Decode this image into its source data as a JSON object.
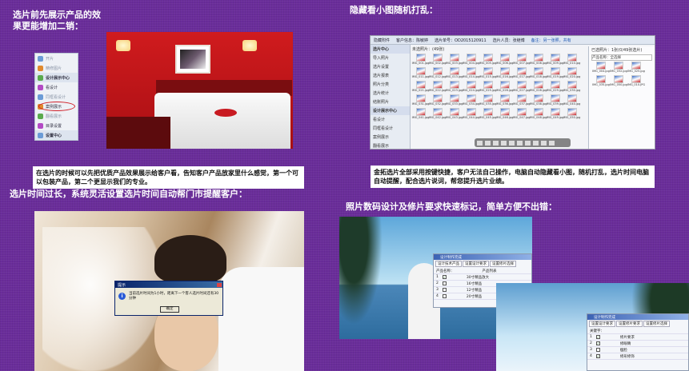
{
  "sections": {
    "top_left_heading": "选片前先展示产品的效果更能增加二销：",
    "top_right_heading": "隐藏看小图随机打乱：",
    "mid_left_heading": "选片时间过长，系统灵活设置选片时间自动帮门市提醒客户：",
    "mid_right_heading": "照片数码设计及修片要求快速标记，简单方便不出错：",
    "caption_left": "在选片的时候可以先把优质产品效果展示给客户看，告知客户产品放家里什么感觉，第一个可以包装产品，第二个更显示我们的专业。",
    "caption_right": "金拓选片全部采用按键快捷，客户无法自己操作，电脑自动隐藏看小图，随机打乱，选片时间电脑自动提醒，配合选片说词，帮您提升选片业绩。"
  },
  "side_menu": {
    "items": [
      {
        "label": "开片",
        "type": "dim"
      },
      {
        "label": "精修图片",
        "type": "dim"
      },
      {
        "label": "设计展示中心",
        "type": "group"
      },
      {
        "label": "看设计",
        "type": "item"
      },
      {
        "label": "同框看设计",
        "type": "dim"
      },
      {
        "label": "案例展示",
        "type": "item"
      },
      {
        "label": "翻看展示",
        "type": "dim"
      },
      {
        "label": "目录设置",
        "type": "item"
      },
      {
        "label": "设置中心",
        "type": "group"
      }
    ]
  },
  "app": {
    "toolbar": [
      "隐藏附件",
      "客户信息：陈敏婷",
      "选片单号：OD2015120911",
      "选片人员：张继博",
      "备注：另一张照，共有"
    ],
    "side_items": [
      {
        "label": "选片中心",
        "group": true
      },
      {
        "label": "导入照片",
        "group": false
      },
      {
        "label": "选片设置",
        "group": false
      },
      {
        "label": "选片报表",
        "group": false
      },
      {
        "label": "照片分类",
        "group": false
      },
      {
        "label": "选片统计",
        "group": false
      },
      {
        "label": "结账照片",
        "group": false
      },
      {
        "label": "设计展示中心",
        "group": true
      },
      {
        "label": "看设计",
        "group": false
      },
      {
        "label": "同框看设计",
        "group": false
      },
      {
        "label": "案例展示",
        "group": false
      },
      {
        "label": "翻看展示",
        "group": false
      },
      {
        "label": "目录设置",
        "group": false
      }
    ],
    "grid_header": "未选照片：(49张)",
    "thumbnails": [
      "IMG_001.jpg",
      "IMG_002.jpg",
      "IMG_003.jpg",
      "IMG_004.jpg",
      "IMG_005.jpg",
      "IMG_006.jpg",
      "IMG_007.jpg",
      "IMG_008.jpg",
      "IMG_009.jpg",
      "IMG_010.jpg",
      "IMG_011.jpg",
      "IMG_012.jpg",
      "IMG_013.jpg",
      "IMG_014.jpg",
      "IMG_015.jpg",
      "IMG_016.jpg",
      "IMG_017.jpg",
      "IMG_018.jpg",
      "IMG_019.jpg",
      "IMG_020.jpg",
      "IMG_021.jpg",
      "IMG_022.jpg",
      "IMG_023.jpg",
      "IMG_024.jpg",
      "IMG_025.jpg",
      "IMG_026.jpg",
      "IMG_027.jpg",
      "IMG_028.jpg",
      "IMG_029.jpg",
      "IMG_030.jpg",
      "IMG_031.jpg",
      "IMG_032.jpg",
      "IMG_033.jpg",
      "IMG_034.jpg",
      "IMG_035.jpg",
      "IMG_036.jpg",
      "IMG_037.jpg",
      "IMG_038.jpg",
      "IMG_039.jpg",
      "IMG_040.jpg",
      "IMG_041.jpg",
      "IMG_042.jpg",
      "IMG_043.jpg",
      "IMG_044.jpg",
      "IMG_045.jpg",
      "IMG_046.jpg",
      "IMG_047.jpg",
      "IMG_048.jpg",
      "IMG_049.jpg",
      "IMG_050.jpg"
    ],
    "right_header": "已选照片：1张(0/49张选片)",
    "right_select": "产品名称：全选择",
    "right_thumbs": [
      "IMG_004.jpg",
      "IMG_032.jpg",
      "IMG_025.jpg",
      "IMG_035.jpg",
      "IMG_050.jpg",
      "IMG_010.JPG"
    ]
  },
  "dialog": {
    "title": "提示",
    "message": "当前选片时间为1小时，距离下一个客人选片时间还有30分钟",
    "ok_label": "确定"
  },
  "panel1": {
    "title": "设计制作完成",
    "tabs": [
      "设计技术产品",
      "设置设计要求",
      "设置修片选择"
    ],
    "field_label": "产品名称：",
    "col_label": "产品列表",
    "rows": [
      {
        "num": "1",
        "checked": true,
        "text": "30寸精品放大"
      },
      {
        "num": "2",
        "checked": false,
        "text": "16寸精品"
      },
      {
        "num": "3",
        "checked": false,
        "text": "12寸精品"
      },
      {
        "num": "4",
        "checked": false,
        "text": "20寸精品"
      }
    ]
  },
  "panel2": {
    "title": "设计制作完成",
    "tabs": [
      "设置设计要求",
      "设置修片要求",
      "设置修片选择"
    ],
    "field_label": "关键字：",
    "rows": [
      {
        "num": "1",
        "checked": true,
        "text": "修片要求"
      },
      {
        "num": "2",
        "checked": true,
        "text": "修眼睛"
      },
      {
        "num": "3",
        "checked": false,
        "text": "瘦脸"
      },
      {
        "num": "4",
        "checked": true,
        "text": "修形修饰"
      }
    ]
  },
  "colors": {
    "background": "#6a2d9a",
    "highlight_circle": "#d0212a",
    "titlebar": "#0a246a"
  }
}
